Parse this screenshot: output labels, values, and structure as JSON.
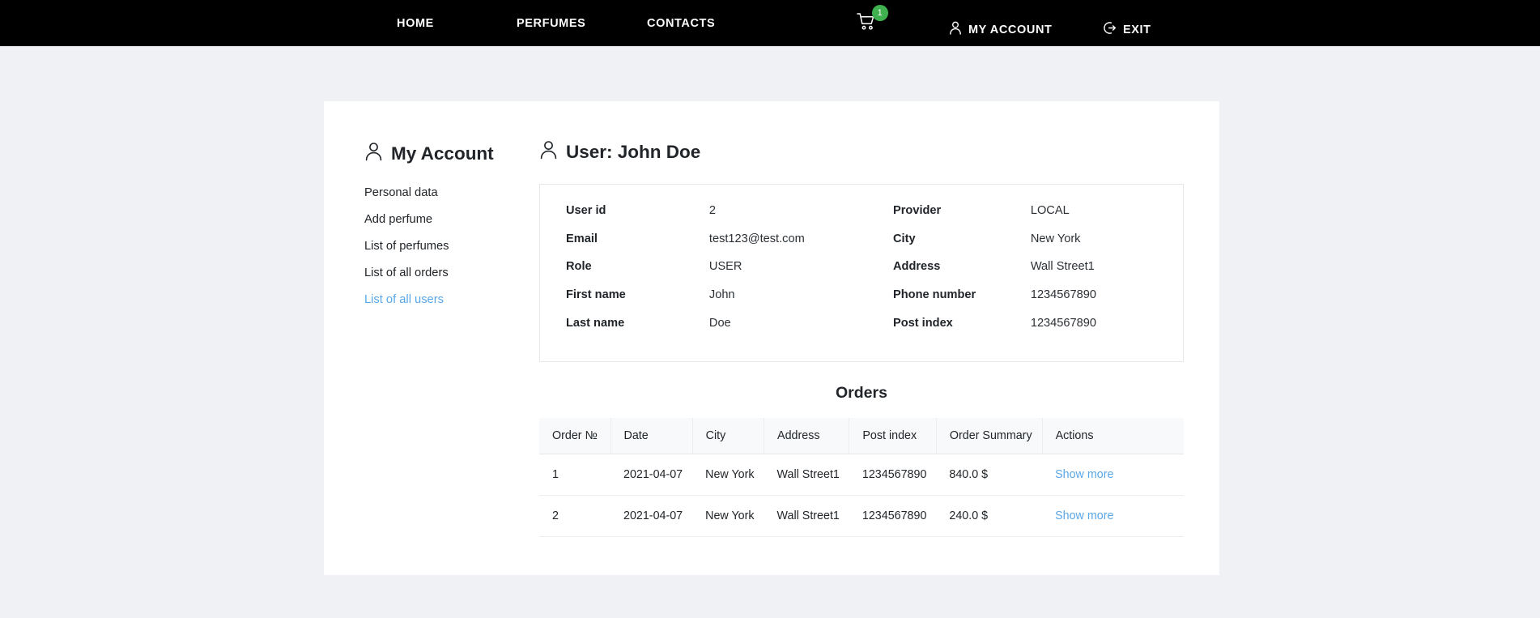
{
  "navbar": {
    "items": [
      {
        "label": "HOME",
        "name": "nav-home"
      },
      {
        "label": "PERFUMES",
        "name": "nav-perfumes"
      },
      {
        "label": "CONTACTS",
        "name": "nav-contacts"
      }
    ],
    "cart": {
      "icon": "shopping-cart-icon",
      "badge_count": "1",
      "badge_color": "#3fb24f"
    },
    "account": {
      "label": "MY ACCOUNT",
      "icon": "user-icon"
    },
    "exit": {
      "label": "EXIT",
      "icon": "logout-icon"
    },
    "background": "#000000"
  },
  "sidebar": {
    "title": "My Account",
    "title_icon": "user-icon",
    "items": [
      {
        "label": "Personal data",
        "active": false
      },
      {
        "label": "Add perfume",
        "active": false
      },
      {
        "label": "List of perfumes",
        "active": false
      },
      {
        "label": "List of all orders",
        "active": false
      },
      {
        "label": "List of all users",
        "active": true
      }
    ],
    "active_color": "#5aa7e8"
  },
  "main": {
    "title": "User: John Doe",
    "title_icon": "user-icon",
    "info_left": [
      {
        "key": "User id",
        "value": "2"
      },
      {
        "key": "Email",
        "value": "test123@test.com"
      },
      {
        "key": "Role",
        "value": "USER"
      },
      {
        "key": "First name",
        "value": "John"
      },
      {
        "key": "Last name",
        "value": "Doe"
      }
    ],
    "info_right": [
      {
        "key": "Provider",
        "value": "LOCAL"
      },
      {
        "key": "City",
        "value": "New York"
      },
      {
        "key": "Address",
        "value": "Wall Street1"
      },
      {
        "key": "Phone number",
        "value": "1234567890"
      },
      {
        "key": "Post index",
        "value": "1234567890"
      }
    ],
    "orders": {
      "title": "Orders",
      "columns": [
        "Order №",
        "Date",
        "City",
        "Address",
        "Post index",
        "Order Summary",
        "Actions"
      ],
      "rows": [
        {
          "order_no": "1",
          "date": "2021-04-07",
          "city": "New York",
          "address": "Wall Street1",
          "post_index": "1234567890",
          "summary": "840.0 $",
          "action": "Show more"
        },
        {
          "order_no": "2",
          "date": "2021-04-07",
          "city": "New York",
          "address": "Wall Street1",
          "post_index": "1234567890",
          "summary": "240.0 $",
          "action": "Show more"
        }
      ],
      "link_color": "#5aa7e8"
    }
  }
}
